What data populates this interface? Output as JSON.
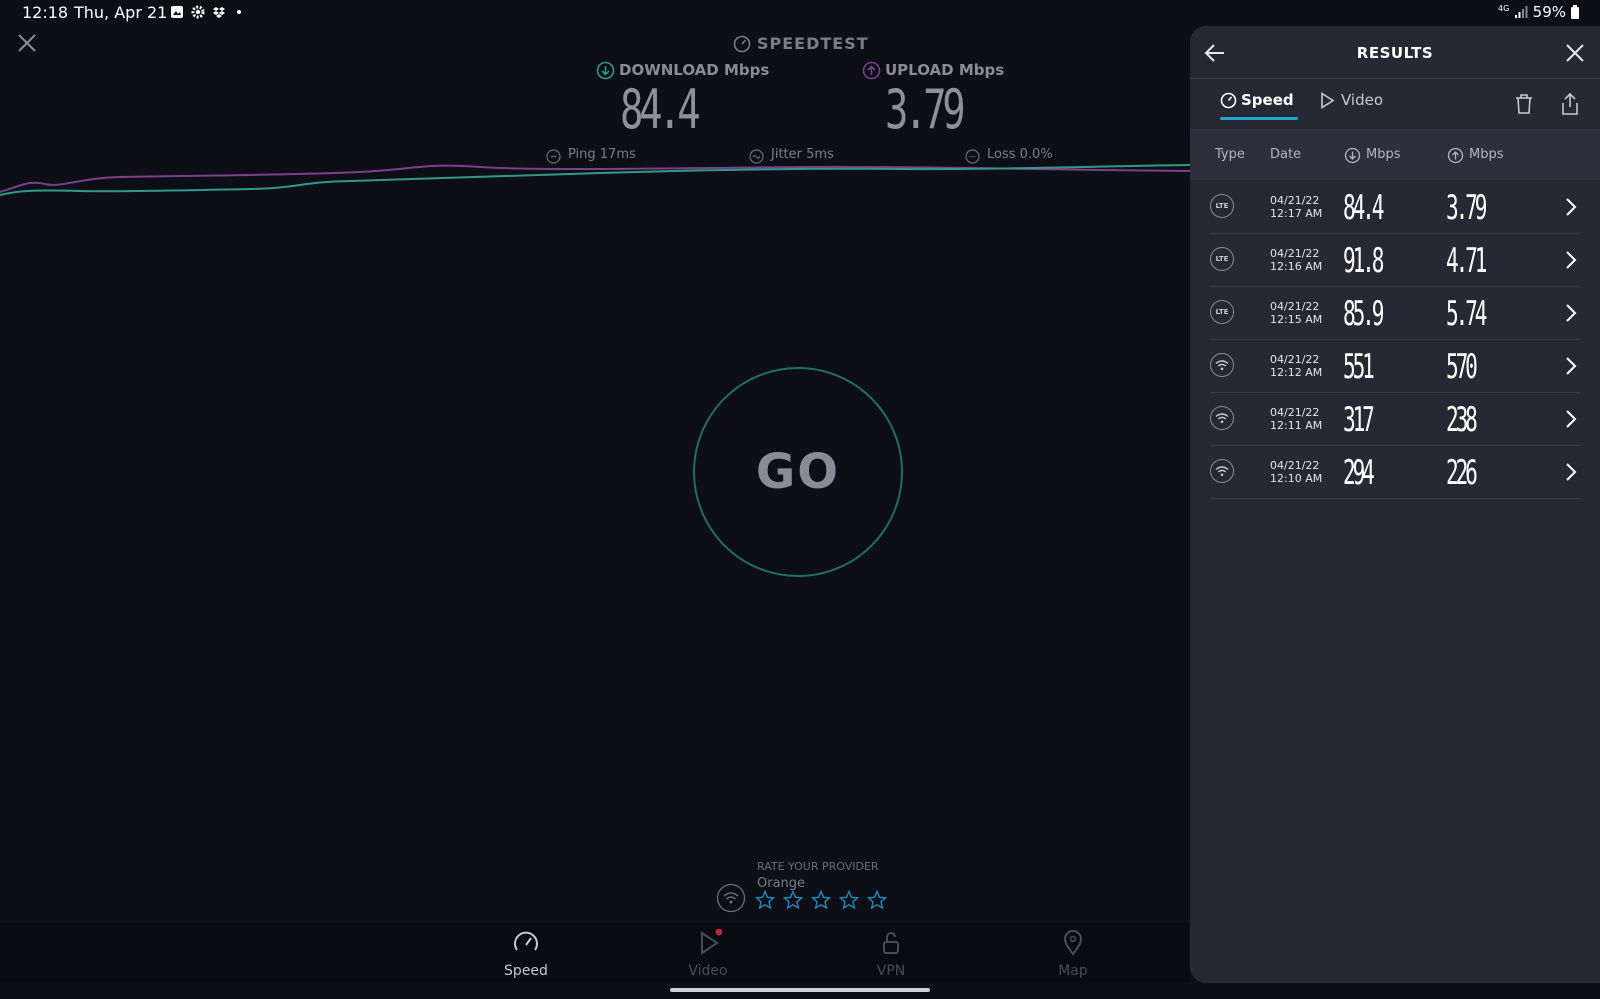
{
  "status": {
    "time": "12:18",
    "date": "Thu, Apr 21",
    "network": "4G",
    "battery": "59%"
  },
  "header": {
    "app_title": "SPEEDTEST",
    "download_label": "DOWNLOAD Mbps",
    "upload_label": "UPLOAD Mbps",
    "download_value": "84.4",
    "upload_value": "3.79"
  },
  "metrics": {
    "ping": "Ping  17ms",
    "jitter": "Jitter  5ms",
    "loss": "Loss  0.0%"
  },
  "go": {
    "label": "GO"
  },
  "rating": {
    "title": "RATE YOUR PROVIDER",
    "provider": "Orange",
    "stars_filled": 0,
    "stars_total": 5
  },
  "nav": [
    {
      "label": "Speed"
    },
    {
      "label": "Video"
    },
    {
      "label": "VPN"
    },
    {
      "label": "Map"
    }
  ],
  "panel": {
    "title": "RESULTS",
    "tabs": [
      {
        "label": "Speed"
      },
      {
        "label": "Video"
      }
    ],
    "columns": {
      "type": "Type",
      "date": "Date",
      "download": "Mbps",
      "upload": "Mbps"
    },
    "rows": [
      {
        "type": "LTE",
        "date": "04/21/22",
        "time": "12:17 AM",
        "download": "84.4",
        "upload": "3.79"
      },
      {
        "type": "LTE",
        "date": "04/21/22",
        "time": "12:16 AM",
        "download": "91.8",
        "upload": "4.71"
      },
      {
        "type": "LTE",
        "date": "04/21/22",
        "time": "12:15 AM",
        "download": "85.9",
        "upload": "5.74"
      },
      {
        "type": "wifi",
        "date": "04/21/22",
        "time": "12:12 AM",
        "download": "551",
        "upload": "570"
      },
      {
        "type": "wifi",
        "date": "04/21/22",
        "time": "12:11 AM",
        "download": "317",
        "upload": "238"
      },
      {
        "type": "wifi",
        "date": "04/21/22",
        "time": "12:10 AM",
        "download": "294",
        "upload": "226"
      }
    ]
  },
  "colors": {
    "accent": "#1fa8d6",
    "download_line": "#2e9a8a",
    "upload_line": "#7a3f8e",
    "go_ring": "#1e6f66"
  }
}
